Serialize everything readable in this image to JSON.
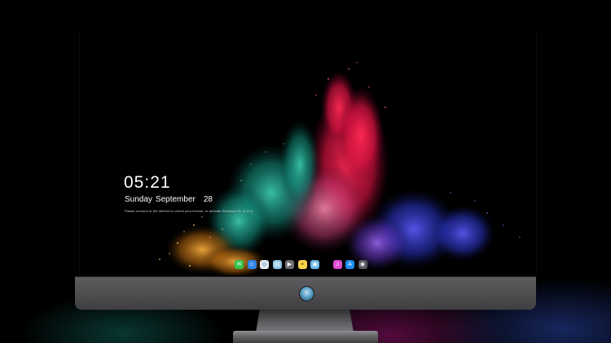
{
  "lockscreen": {
    "time": "05:21",
    "weekday": "Sunday",
    "month": "September",
    "day": "28",
    "notice": "Please connect to the internet to check your license, or activate Windows 10. (1.0.0)"
  },
  "dock": {
    "items": [
      {
        "name": "messages",
        "symbol": "✉",
        "color": "#2fc24a"
      },
      {
        "name": "finder",
        "symbol": "☺",
        "color": "#2f86e6"
      },
      {
        "name": "safari",
        "symbol": "◎",
        "color": "#e9e9ef"
      },
      {
        "name": "preview",
        "symbol": "▤",
        "color": "#8fc7e8"
      },
      {
        "name": "clapper",
        "symbol": "▶",
        "color": "#6d6d74"
      },
      {
        "name": "notes",
        "symbol": "≡",
        "color": "#f7d14a"
      },
      {
        "name": "photos",
        "symbol": "▣",
        "color": "#6ab7e9"
      },
      {
        "name": "itunes",
        "symbol": "♫",
        "color": "#e04bd2"
      },
      {
        "name": "app-store",
        "symbol": "A",
        "color": "#1e8bf0"
      },
      {
        "name": "camera",
        "symbol": "◉",
        "color": "#5b5b63"
      }
    ]
  },
  "colors": {
    "desktop": "#000000",
    "bezel": "#555557",
    "stand": "#6a6a6d"
  }
}
